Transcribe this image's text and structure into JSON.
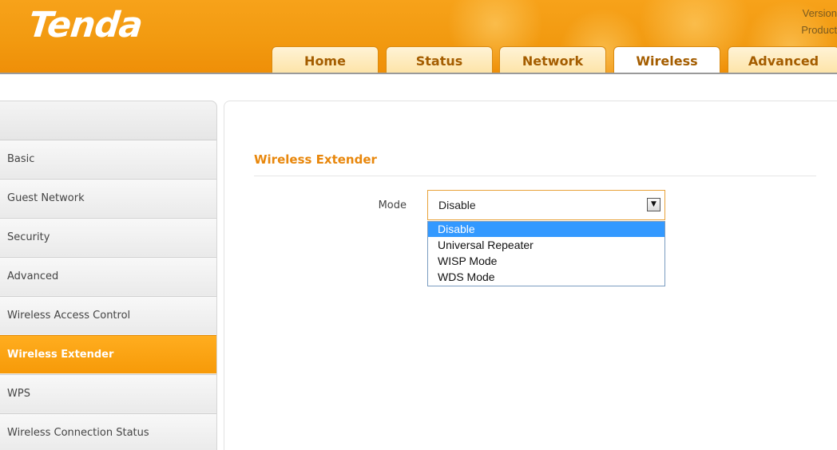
{
  "header": {
    "logo": "Tenda",
    "info": [
      "Version",
      "Product"
    ]
  },
  "nav": {
    "tabs": [
      {
        "label": "Home",
        "active": false
      },
      {
        "label": "Status",
        "active": false
      },
      {
        "label": "Network",
        "active": false
      },
      {
        "label": "Wireless",
        "active": true
      },
      {
        "label": "Advanced",
        "active": false
      }
    ]
  },
  "sidebar": {
    "items": [
      {
        "label": "Basic",
        "active": false
      },
      {
        "label": "Guest Network",
        "active": false
      },
      {
        "label": "Security",
        "active": false
      },
      {
        "label": "Advanced",
        "active": false
      },
      {
        "label": "Wireless Access Control",
        "active": false
      },
      {
        "label": "Wireless Extender",
        "active": true
      },
      {
        "label": "WPS",
        "active": false
      },
      {
        "label": "Wireless Connection Status",
        "active": false
      }
    ]
  },
  "main": {
    "section_title": "Wireless Extender",
    "mode": {
      "label": "Mode",
      "value": "Disable",
      "options": [
        "Disable",
        "Universal Repeater",
        "WISP Mode",
        "WDS Mode"
      ],
      "highlighted_option": "Disable"
    }
  },
  "colors": {
    "brand_orange": "#f29a10",
    "accent_text": "#e8870c",
    "selection_blue": "#3399ff"
  }
}
